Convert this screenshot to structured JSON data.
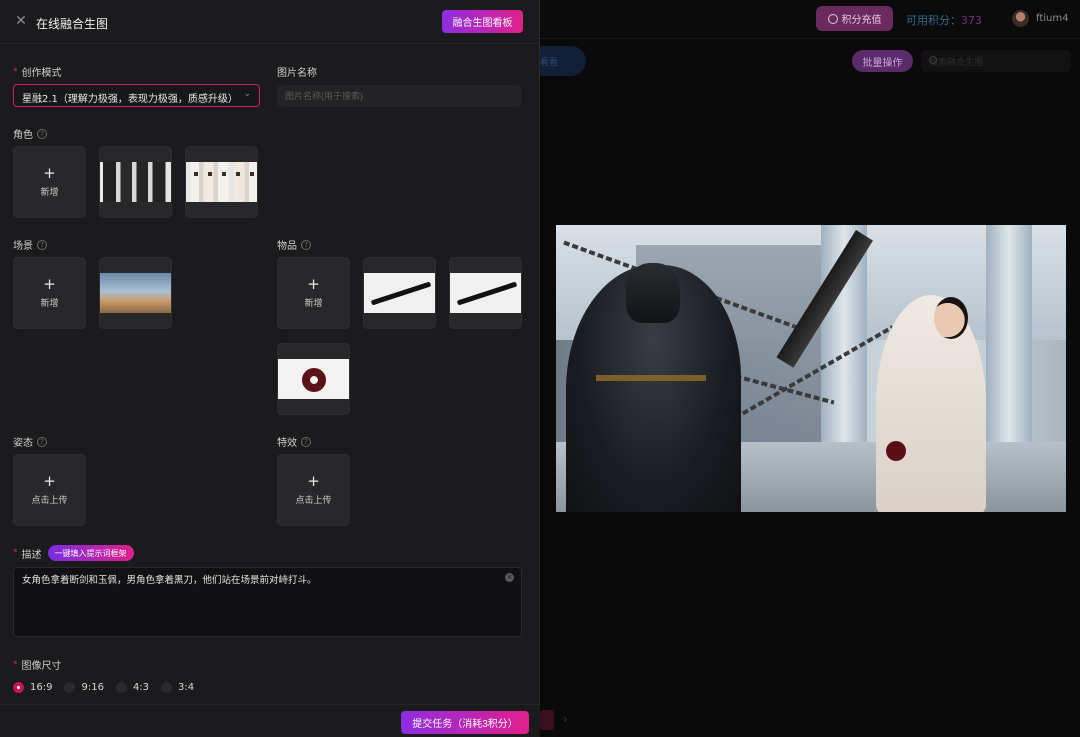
{
  "header": {
    "recharge_label": "积分充值",
    "credits_label": "可用积分：",
    "credits_value": "373",
    "username": "ftium4",
    "search_placeholder": "搜索融合生图",
    "batch_label": "批量操作",
    "left_pill_label": "看看"
  },
  "drawer": {
    "title": "在线融合生图",
    "board_button": "融合生图看板",
    "mode": {
      "label": "创作模式",
      "value": "星融2.1（理解力极强，表现力极强，质感升级）"
    },
    "image_name": {
      "label": "图片名称",
      "placeholder": "图片名称(用于搜索)"
    },
    "roles": {
      "label": "角色",
      "add_label": "新增"
    },
    "scene": {
      "label": "场景",
      "add_label": "新增"
    },
    "items": {
      "label": "物品",
      "add_label": "新增"
    },
    "pose": {
      "label": "姿态",
      "upload_label": "点击上传"
    },
    "effects": {
      "label": "特效",
      "upload_label": "点击上传"
    },
    "description": {
      "label": "描述",
      "fill_button": "一键填入提示词框架",
      "text": "女角色拿着断剑和玉佩，男角色拿着黑刀，他们站在场景前对峙打斗。"
    },
    "size": {
      "label": "图像尺寸",
      "options": [
        "16:9",
        "9:16",
        "4:3",
        "3:4"
      ],
      "selected": "16:9"
    },
    "submit_button": "提交任务（消耗3积分）"
  },
  "colors": {
    "accent_gradient_start": "#8e2de2",
    "accent_gradient_end": "#e0208a",
    "required_mark": "#e0206a"
  }
}
